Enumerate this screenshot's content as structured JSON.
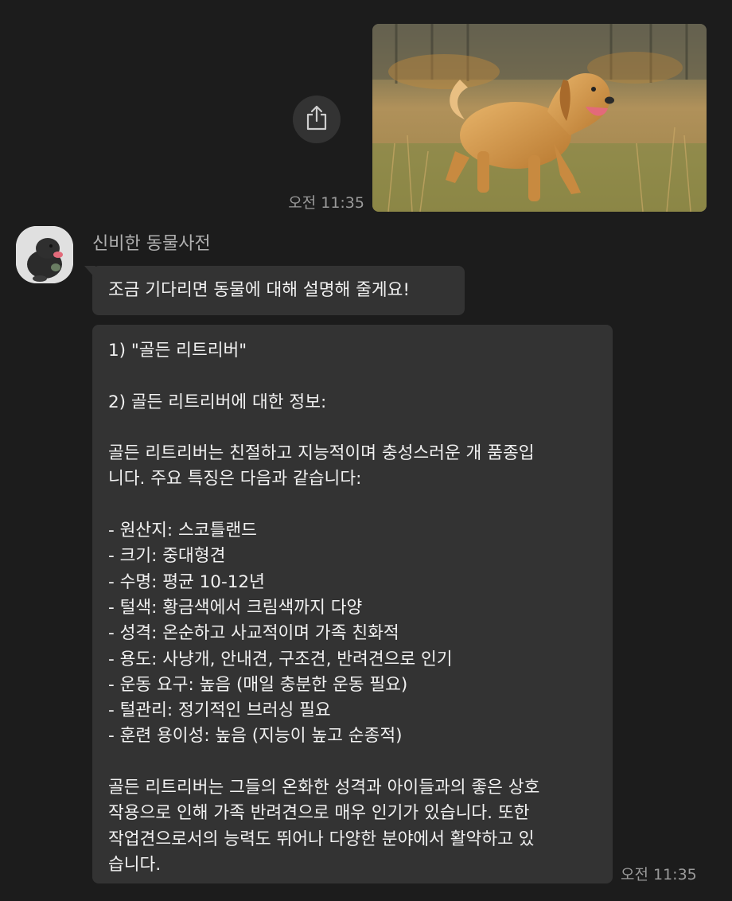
{
  "outgoing": {
    "share_icon": "share-icon",
    "photo_subject": "golden retriever running in a field",
    "time": "오전 11:35"
  },
  "incoming": {
    "sender_name": "신비한 동물사전",
    "avatar_icon": "niffler-avatar",
    "first_message": "조금 기다리면 동물에 대해 설명해 줄게요!",
    "detail_lines": [
      "1) \"골든 리트리버\"",
      "",
      "2) 골든 리트리버에 대한 정보:",
      "",
      "골든 리트리버는 친절하고 지능적이며 충성스러운 개 품종입",
      "니다. 주요 특징은 다음과 같습니다:",
      "",
      "- 원산지: 스코틀랜드",
      "- 크기: 중대형견",
      "- 수명: 평균 10-12년",
      "- 털색: 황금색에서 크림색까지 다양",
      "- 성격: 온순하고 사교적이며 가족 친화적",
      "- 용도: 사냥개, 안내견, 구조견, 반려견으로 인기",
      "- 운동 요구: 높음 (매일 충분한 운동 필요)",
      "- 털관리: 정기적인 브러싱 필요",
      "- 훈련 용이성: 높음 (지능이 높고 순종적)",
      "",
      "골든 리트리버는 그들의 온화한 성격과 아이들과의 좋은 상호",
      "작용으로 인해 가족 반려견으로 매우 인기가 있습니다. 또한",
      "작업견으로서의 능력도 뛰어나 다양한 분야에서 활약하고 있",
      "습니다."
    ],
    "time": "오전 11:35"
  },
  "colors": {
    "background": "#1c1c1c",
    "bubble": "#333333",
    "text": "#f1f1f1",
    "muted": "#9a9a9a"
  }
}
